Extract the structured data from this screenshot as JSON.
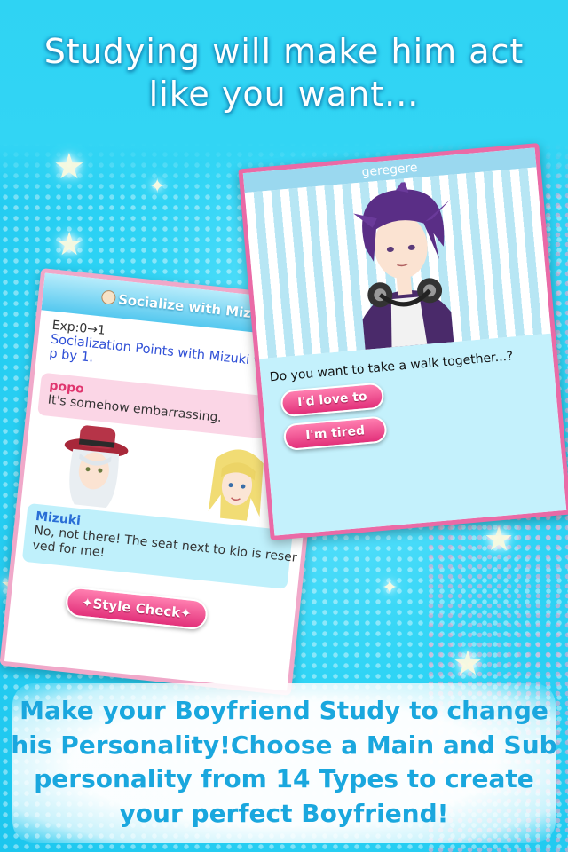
{
  "headline": {
    "line1": "Studying will make him act",
    "line2": "like you want..."
  },
  "left_card": {
    "title": "Socialize with Mizuki",
    "exp": "Exp:0→1",
    "social_line1": "Socialization Points with Mizuki we",
    "social_line2": "p by 1.",
    "bubble1": {
      "name": "popo",
      "text": "It's somehow embarrassing."
    },
    "bubble2": {
      "name": "Mizuki",
      "text_line1": "No, not there! The seat next to kio is reser",
      "text_line2": "ved for me!"
    },
    "style_button": "✦Style Check✦"
  },
  "right_card": {
    "title": "geregere",
    "question": "Do you want to take a walk together...?",
    "option1": "I'd love to",
    "option2": "I'm tired"
  },
  "bottom_text": {
    "line1": "Make your Boyfriend Study to change",
    "line2": "his Personality!Choose a Main and Sub",
    "line3": "personality from 14 Types to create",
    "line4": "your perfect Boyfriend!"
  },
  "colors": {
    "background": "#2fd4f5",
    "accent_pink": "#e2307a",
    "card_border_pink": "#ea6aa6",
    "text_blue": "#1aa7de"
  },
  "icons": [
    "star-icon",
    "bear-icon",
    "sparkle-icon"
  ]
}
